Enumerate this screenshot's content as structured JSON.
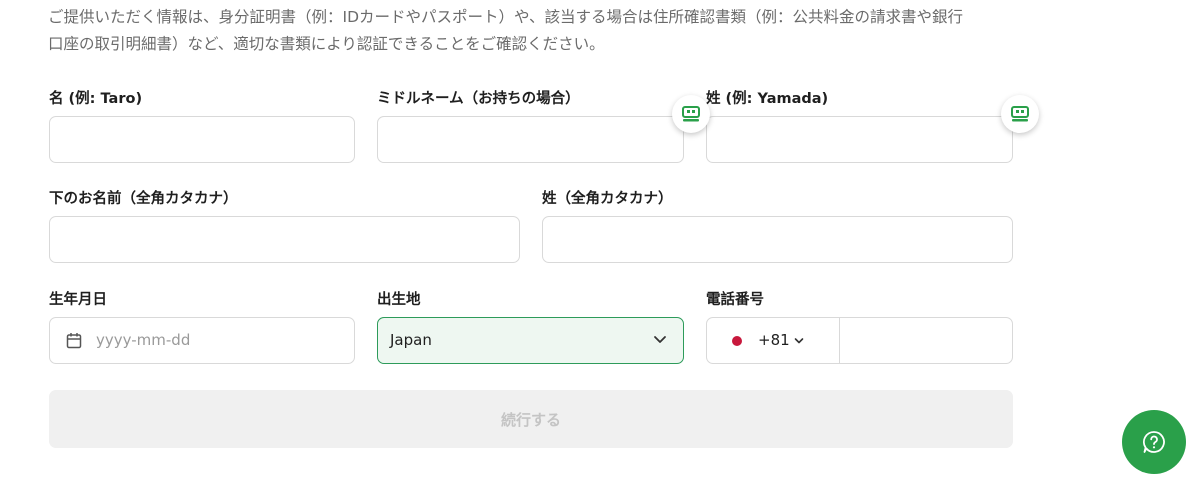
{
  "intro": {
    "line1": "ご提供いただく情報は、身分証明書（例：IDカードやパスポート）や、該当する場合は住所確認書類（例：公共料金の請求書や銀行",
    "line2": "口座の取引明細書）など、適切な書類により認証できることをご確認ください。"
  },
  "form": {
    "first_name_label": "名 (例: Taro)",
    "first_name_value": "",
    "middle_name_label": "ミドルネーム（お持ちの場合）",
    "middle_name_value": "",
    "last_name_label": "姓 (例: Yamada)",
    "last_name_value": "",
    "first_name_kana_label": "下のお名前（全角カタカナ）",
    "first_name_kana_value": "",
    "last_name_kana_label": "姓（全角カタカナ）",
    "last_name_kana_value": "",
    "dob_label": "生年月日",
    "dob_placeholder": "yyyy-mm-dd",
    "birthplace_label": "出生地",
    "birthplace_value": "Japan",
    "phone_label": "電話番号",
    "phone_country_code": "+81",
    "phone_value": ""
  },
  "icons": {
    "autofill": "autofill-card-icon",
    "calendar": "calendar-icon",
    "chevron": "chevron-down-icon",
    "flag": "japan-flag-icon",
    "help": "help-chat-icon"
  },
  "colors": {
    "accent": "#2aa04a",
    "select_border": "#2d9b5a",
    "select_bg": "#eef7f1",
    "flag": "#c8183c"
  },
  "actions": {
    "continue_label": "続行する"
  }
}
